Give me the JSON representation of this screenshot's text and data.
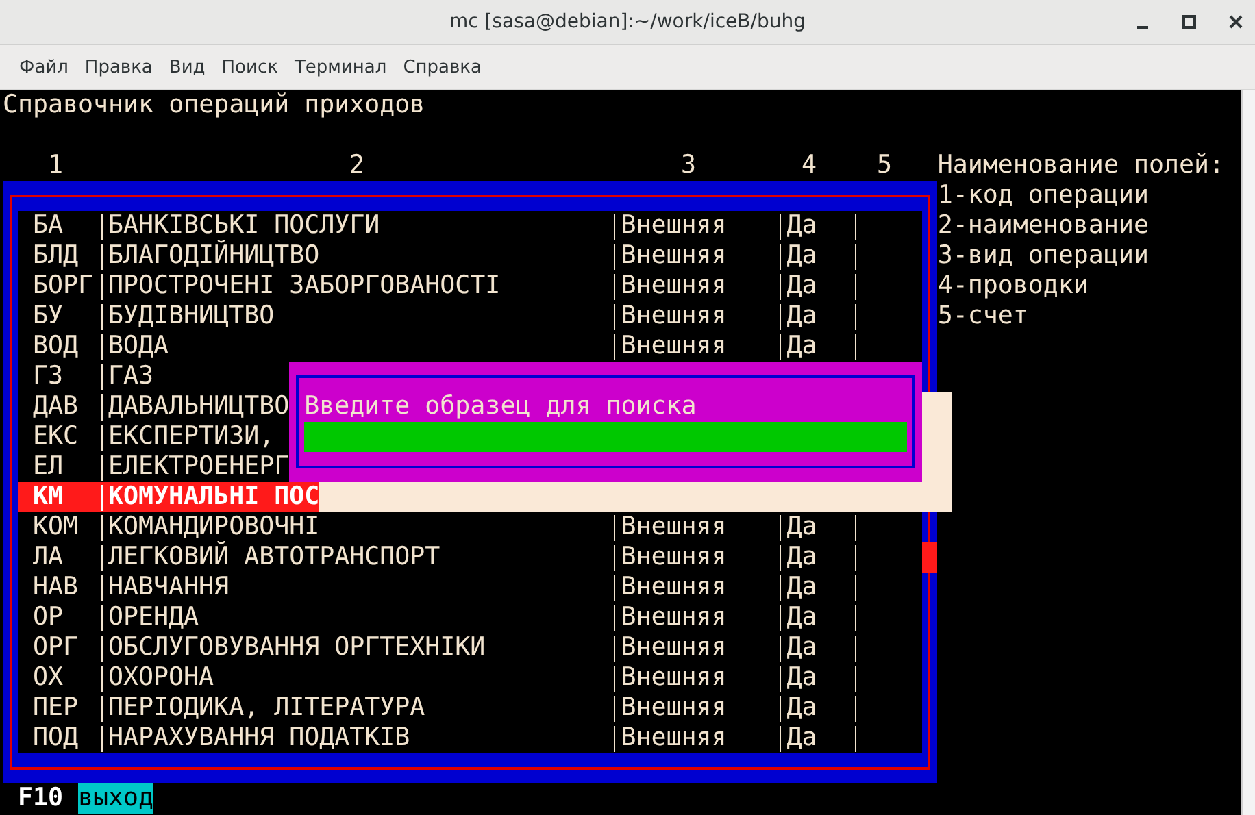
{
  "window": {
    "title": "mc [sasa@debian]:~/work/iceB/buhg"
  },
  "menu": [
    "Файл",
    "Правка",
    "Вид",
    "Поиск",
    "Терминал",
    "Справка"
  ],
  "terminal": {
    "heading": "Справочник операций приходов",
    "table": {
      "columns": [
        "1",
        "2",
        "3",
        "4",
        "5"
      ],
      "rows": [
        {
          "code": "БА",
          "name": "БАНКІВСЬКІ ПОСЛУГИ",
          "type": "Внешняя",
          "flag": "Да",
          "selected": false
        },
        {
          "code": "БЛД",
          "name": "БЛАГОДІЙНИЦТВО",
          "type": "Внешняя",
          "flag": "Да",
          "selected": false
        },
        {
          "code": "БОРГ",
          "name": "ПРОСТРОЧЕНІ ЗАБОРГОВАНОСТІ",
          "type": "Внешняя",
          "flag": "Да",
          "selected": false
        },
        {
          "code": "БУ",
          "name": "БУДІВНИЦТВО",
          "type": "Внешняя",
          "flag": "Да",
          "selected": false
        },
        {
          "code": "ВОД",
          "name": "ВОДА",
          "type": "Внешняя",
          "flag": "Да",
          "selected": false
        },
        {
          "code": "ГЗ",
          "name": "ГАЗ",
          "selected": false
        },
        {
          "code": "ДАВ",
          "name": "ДАВАЛЬНИЦТВО",
          "selected": false
        },
        {
          "code": "ЕКС",
          "name": "ЕКСПЕРТИЗИ,",
          "selected": false
        },
        {
          "code": "ЕЛ",
          "name": "ЕЛЕКТРОЕНЕРГ",
          "selected": false
        },
        {
          "code": "КМ",
          "name": "КОМУНАЛЬНІ ПОС",
          "selected": true
        },
        {
          "code": "КОМ",
          "name": "КОМАНДИРОВОЧНІ",
          "type": "Внешняя",
          "flag": "Да",
          "selected": false
        },
        {
          "code": "ЛА",
          "name": "ЛЕГКОВИЙ АВТОТРАНСПОРТ",
          "type": "Внешняя",
          "flag": "Да",
          "selected": false
        },
        {
          "code": "НАВ",
          "name": "НАВЧАННЯ",
          "type": "Внешняя",
          "flag": "Да",
          "selected": false
        },
        {
          "code": "ОР",
          "name": "ОРЕНДА",
          "type": "Внешняя",
          "flag": "Да",
          "selected": false
        },
        {
          "code": "ОРГ",
          "name": "ОБСЛУГОВУВАННЯ ОРГТЕХНІКИ",
          "type": "Внешняя",
          "flag": "Да",
          "selected": false
        },
        {
          "code": "ОХ",
          "name": "ОХОРОНА",
          "type": "Внешняя",
          "flag": "Да",
          "selected": false
        },
        {
          "code": "ПЕР",
          "name": "ПЕРІОДИКА, ЛІТЕРАТУРА",
          "type": "Внешняя",
          "flag": "Да",
          "selected": false
        },
        {
          "code": "ПОД",
          "name": "НАРАХУВАННЯ ПОДАТКІВ",
          "type": "Внешняя",
          "flag": "Да",
          "selected": false
        }
      ]
    },
    "legend": [
      "Наименование полей:",
      "1-код операции",
      "2-наименование",
      "3-вид операции",
      "4-проводки",
      "5-счет"
    ],
    "dialog": {
      "prompt": "Введите образец для поиска"
    },
    "function_keys": [
      {
        "key": "F10",
        "label": "выход"
      }
    ]
  }
}
